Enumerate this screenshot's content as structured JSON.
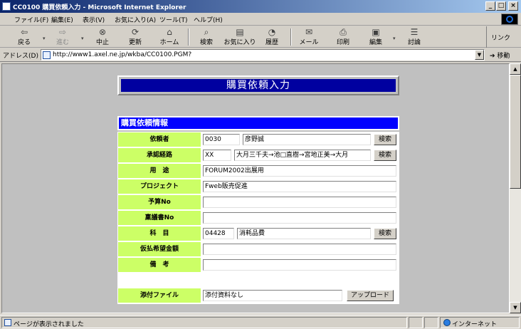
{
  "window": {
    "title": "CC0100 購買依頼入力 - Microsoft Internet Explorer",
    "minimize": "_",
    "maximize": "□",
    "close": "×"
  },
  "menu": [
    "ファイル(F)",
    "編集(E)",
    "表示(V)",
    "お気に入り(A)",
    "ツール(T)",
    "ヘルプ(H)"
  ],
  "toolbar": {
    "back": "戻る",
    "forward": "進む",
    "stop": "中止",
    "refresh": "更新",
    "home": "ホーム",
    "search": "検索",
    "favorites": "お気に入り",
    "history": "履歴",
    "mail": "メール",
    "print": "印刷",
    "edit": "編集",
    "discuss": "討論",
    "links": "リンク"
  },
  "address": {
    "label": "アドレス(D)",
    "url": "http://www1.axel.ne.jp/wkba/CC0100.PGM?",
    "go": "移動"
  },
  "page": {
    "title": "購買依頼入力",
    "section_title": "購買依頼情報",
    "fields": {
      "requester": {
        "label": "依頼者",
        "code": "0030",
        "name": "彦野誠",
        "button": "検索"
      },
      "approval_route": {
        "label": "承認経路",
        "code": "XX",
        "route": "大月三千夫→池□直樹→宮地正美→大月",
        "button": "検索"
      },
      "purpose": {
        "label": "用　途",
        "value": "FORUM2002出展用"
      },
      "project": {
        "label": "プロジェクト",
        "value": "Fweb販売促進"
      },
      "budget_no": {
        "label": "予算No",
        "value": ""
      },
      "proposal_no": {
        "label": "稟議書No",
        "value": ""
      },
      "account": {
        "label": "科　目",
        "code": "04428",
        "name": "消耗品費",
        "button": "検索"
      },
      "advance_amount": {
        "label": "仮払希望金額",
        "value": ""
      },
      "remarks": {
        "label": "備　考",
        "value": ""
      }
    },
    "attachment": {
      "label": "添付ファイル",
      "value": "添付資料なし",
      "button": "アップロード"
    }
  },
  "status": {
    "message": "ページが表示されました",
    "zone": "インターネット"
  },
  "colors": {
    "title_bar": "#0a246a",
    "page_title_bg": "#0000a0",
    "section_bg": "#0000ff",
    "label_bg": "#ccff66",
    "viewport_bg": "#c0c0c0"
  }
}
